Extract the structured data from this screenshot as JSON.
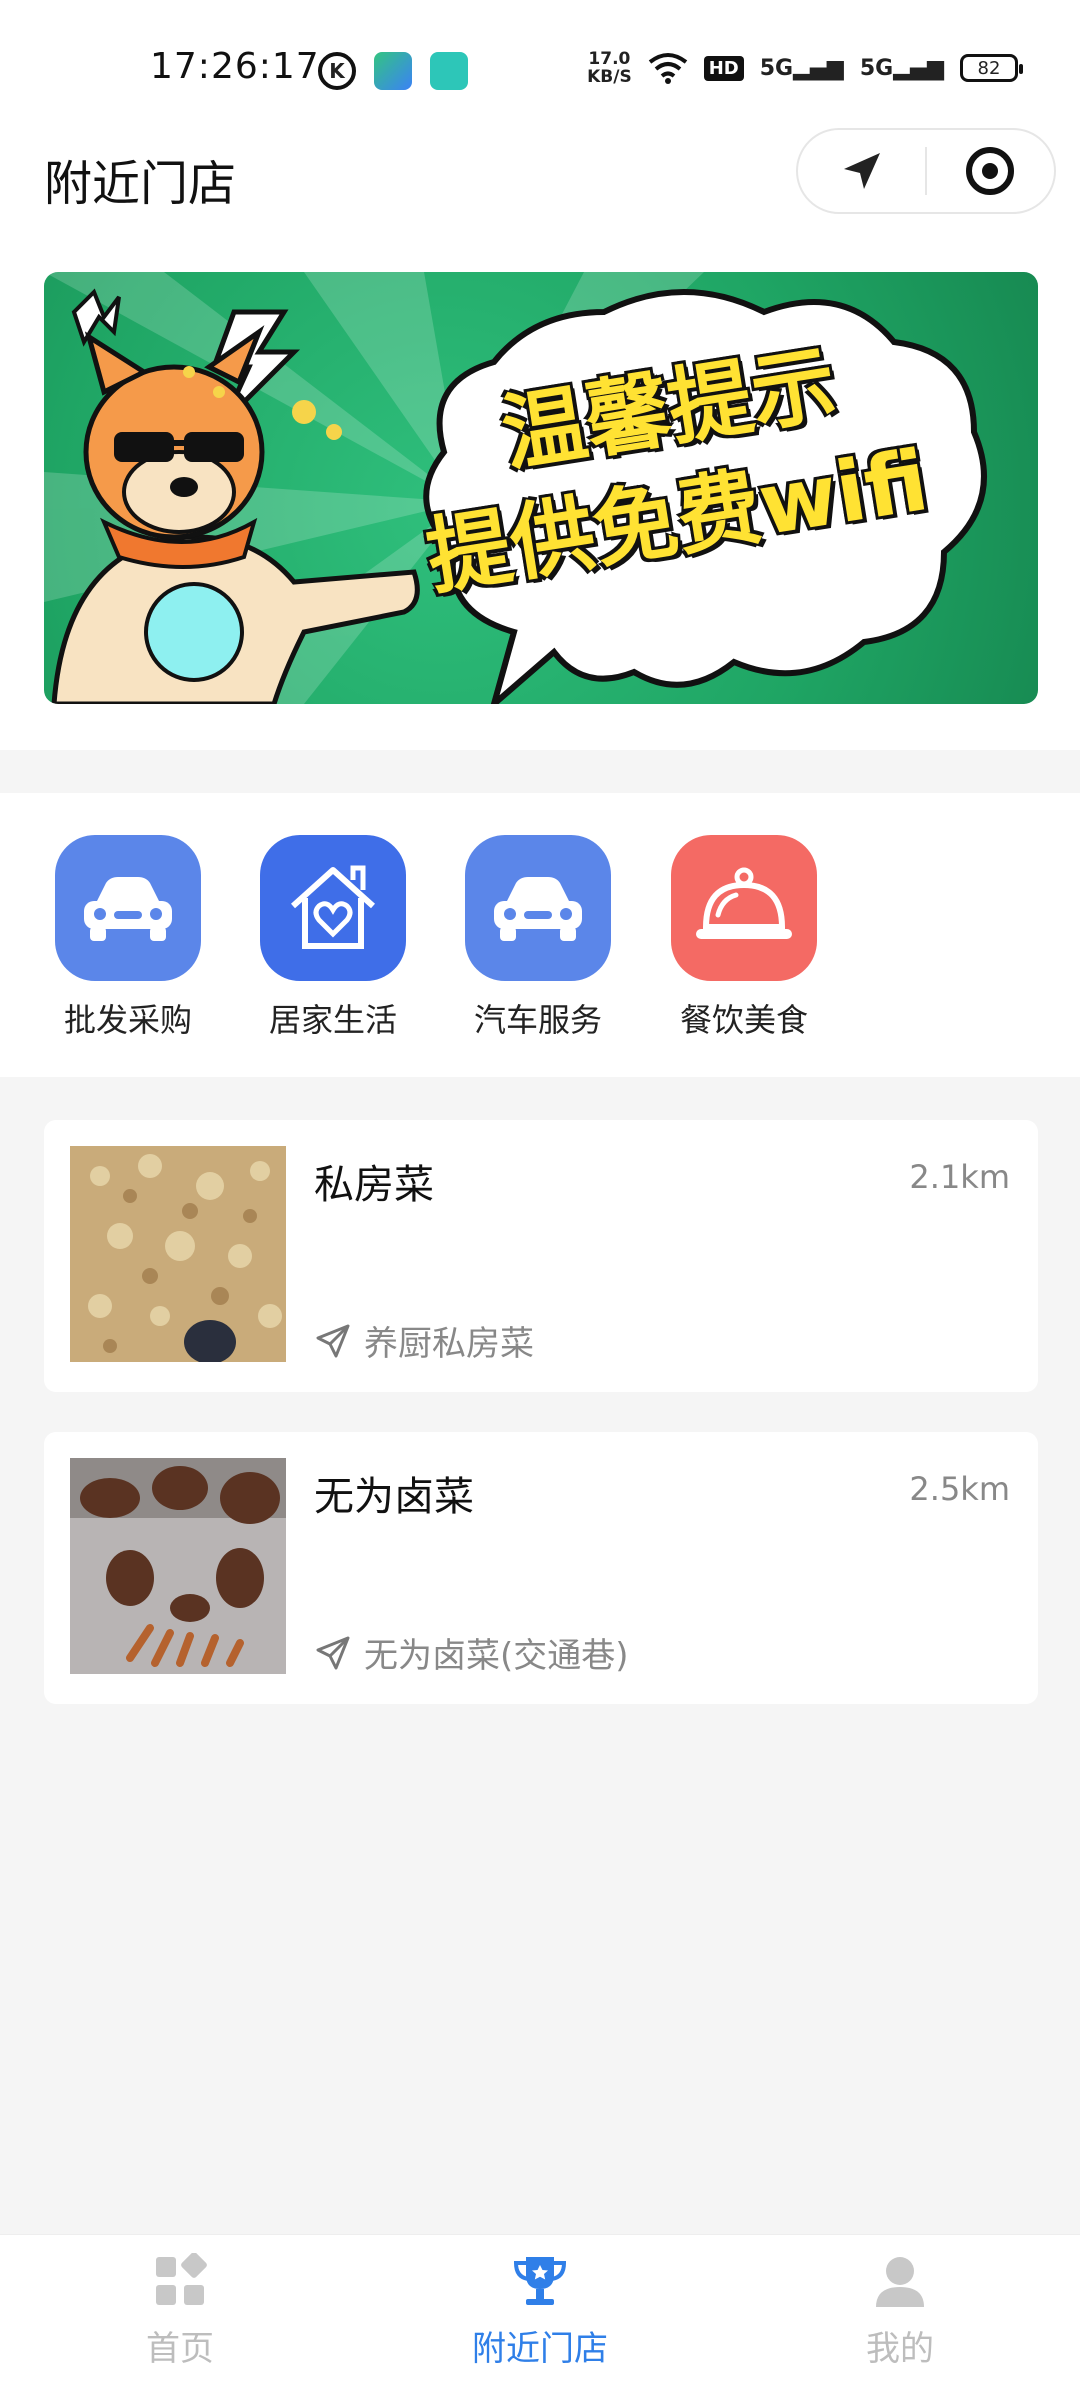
{
  "status_bar": {
    "time": "17:26:17",
    "net_speed_value": "17.0",
    "net_speed_unit": "KB/S",
    "hd_badge": "HD",
    "signal1": "5G",
    "signal2": "5G",
    "battery": "82"
  },
  "header": {
    "title": "附近门店"
  },
  "banner": {
    "line1": "温馨提示",
    "line2": "提供免费wifi"
  },
  "categories": [
    {
      "label": "批发采购",
      "icon": "car-icon",
      "color": "#5b86e9"
    },
    {
      "label": "居家生活",
      "icon": "house-heart-icon",
      "color": "#3f6ee8"
    },
    {
      "label": "汽车服务",
      "icon": "car-icon",
      "color": "#5b86e9"
    },
    {
      "label": "餐饮美食",
      "icon": "food-cloche-icon",
      "color": "#f46a64"
    }
  ],
  "stores": [
    {
      "name": "私房菜",
      "distance": "2.1km",
      "address": "养厨私房菜"
    },
    {
      "name": "无为卤菜",
      "distance": "2.5km",
      "address": "无为卤菜(交通巷)"
    }
  ],
  "tabbar": {
    "tabs": [
      {
        "label": "首页",
        "icon": "grid-icon"
      },
      {
        "label": "附近门店",
        "icon": "trophy-icon",
        "active": true
      },
      {
        "label": "我的",
        "icon": "user-icon"
      }
    ]
  },
  "colors": {
    "accent": "#2f7fe8",
    "banner_green": "#1fa564",
    "banner_text": "#ffe233"
  }
}
